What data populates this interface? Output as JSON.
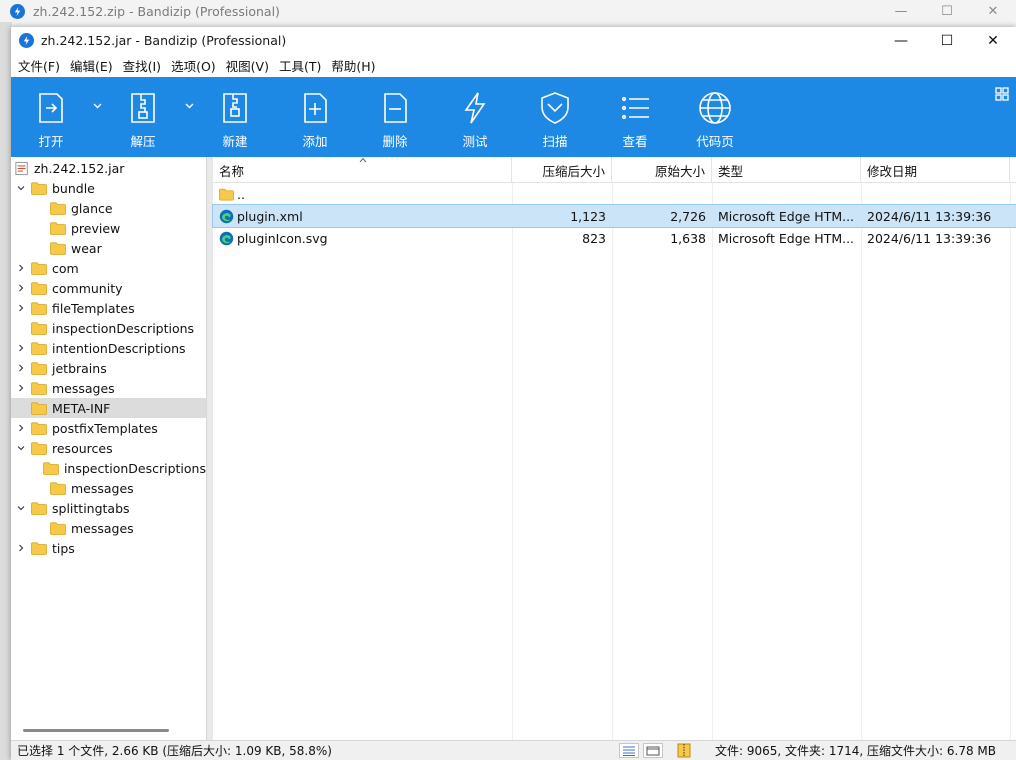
{
  "background_window": {
    "title": "zh.242.152.zip - Bandizip (Professional)"
  },
  "window": {
    "title": "zh.242.152.jar - Bandizip (Professional)"
  },
  "menu": [
    "文件(F)",
    "编辑(E)",
    "查找(I)",
    "选项(O)",
    "视图(V)",
    "工具(T)",
    "帮助(H)"
  ],
  "toolbar": {
    "open": "打开",
    "extract": "解压",
    "new": "新建",
    "add": "添加",
    "delete": "删除",
    "test": "测试",
    "scan": "扫描",
    "view": "查看",
    "codepage": "代码页"
  },
  "tree": [
    {
      "label": "zh.242.152.jar",
      "depth": 0,
      "chevron": "none",
      "icon": "jar-icon"
    },
    {
      "label": "bundle",
      "depth": 0,
      "chevron": "down",
      "icon": "folder-icon"
    },
    {
      "label": "glance",
      "depth": 1,
      "chevron": "none",
      "icon": "folder-icon"
    },
    {
      "label": "preview",
      "depth": 1,
      "chevron": "none",
      "icon": "folder-icon"
    },
    {
      "label": "wear",
      "depth": 1,
      "chevron": "none",
      "icon": "folder-icon"
    },
    {
      "label": "com",
      "depth": 0,
      "chevron": "right",
      "icon": "folder-icon"
    },
    {
      "label": "community",
      "depth": 0,
      "chevron": "right",
      "icon": "folder-icon"
    },
    {
      "label": "fileTemplates",
      "depth": 0,
      "chevron": "right",
      "icon": "folder-icon"
    },
    {
      "label": "inspectionDescriptions",
      "depth": 0,
      "chevron": "none",
      "icon": "folder-icon"
    },
    {
      "label": "intentionDescriptions",
      "depth": 0,
      "chevron": "right",
      "icon": "folder-icon"
    },
    {
      "label": "jetbrains",
      "depth": 0,
      "chevron": "right",
      "icon": "folder-icon"
    },
    {
      "label": "messages",
      "depth": 0,
      "chevron": "right",
      "icon": "folder-icon"
    },
    {
      "label": "META-INF",
      "depth": 0,
      "chevron": "none",
      "icon": "folder-icon",
      "selected": true
    },
    {
      "label": "postfixTemplates",
      "depth": 0,
      "chevron": "right",
      "icon": "folder-icon"
    },
    {
      "label": "resources",
      "depth": 0,
      "chevron": "down",
      "icon": "folder-icon"
    },
    {
      "label": "inspectionDescriptions",
      "depth": 1,
      "chevron": "none",
      "icon": "folder-icon"
    },
    {
      "label": "messages",
      "depth": 1,
      "chevron": "none",
      "icon": "folder-icon"
    },
    {
      "label": "splittingtabs",
      "depth": 0,
      "chevron": "down",
      "icon": "folder-icon"
    },
    {
      "label": "messages",
      "depth": 1,
      "chevron": "none",
      "icon": "folder-icon"
    },
    {
      "label": "tips",
      "depth": 0,
      "chevron": "right",
      "icon": "folder-icon"
    }
  ],
  "columns": {
    "name": "名称",
    "compressed": "压缩后大小",
    "original": "原始大小",
    "type": "类型",
    "modified": "修改日期"
  },
  "files": [
    {
      "name": "..",
      "compressed": "",
      "original": "",
      "type": "",
      "modified": "",
      "icon": "folder-icon"
    },
    {
      "name": "plugin.xml",
      "compressed": "1,123",
      "original": "2,726",
      "type": "Microsoft Edge HTM...",
      "modified": "2024/6/11 13:39:36",
      "icon": "edge-icon",
      "selected": true
    },
    {
      "name": "pluginIcon.svg",
      "compressed": "823",
      "original": "1,638",
      "type": "Microsoft Edge HTM...",
      "modified": "2024/6/11 13:39:36",
      "icon": "edge-icon"
    }
  ],
  "status": {
    "left": "已选择 1 个文件, 2.66 KB (压缩后大小: 1.09 KB, 58.8%)",
    "right": "文件: 9065, 文件夹: 1714, 压缩文件大小: 6.78 MB"
  },
  "colors": {
    "toolbar_bg": "#1e88e5",
    "selection_bg": "#cce4f7",
    "folder_yellow": "#f7c948"
  }
}
